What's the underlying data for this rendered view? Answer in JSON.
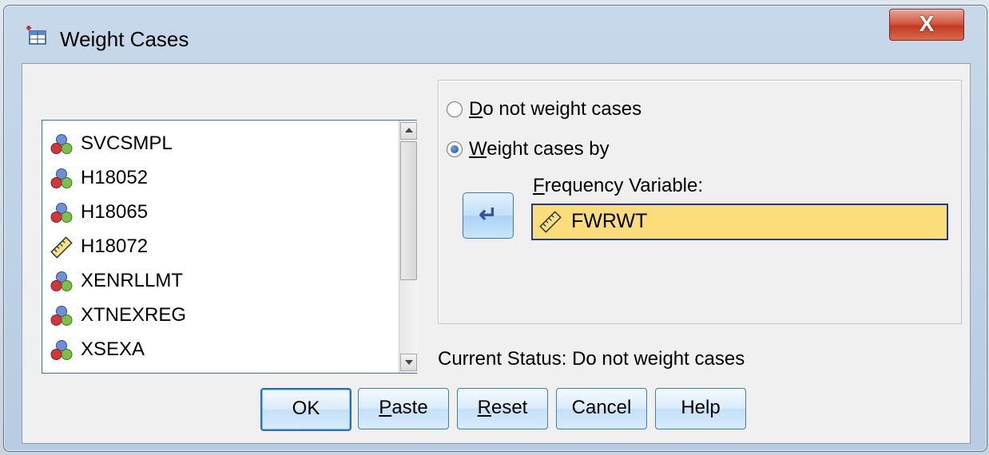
{
  "window": {
    "title": "Weight Cases",
    "close_label": "X"
  },
  "variables": [
    {
      "name": "SVCSMPL",
      "icon": "nominal-icon"
    },
    {
      "name": "H18052",
      "icon": "nominal-icon"
    },
    {
      "name": "H18065",
      "icon": "nominal-icon"
    },
    {
      "name": "H18072",
      "icon": "scale-ruler-icon"
    },
    {
      "name": "XENRLLMT",
      "icon": "nominal-icon"
    },
    {
      "name": "XTNEXREG",
      "icon": "nominal-icon"
    },
    {
      "name": "XSEXA",
      "icon": "nominal-icon"
    }
  ],
  "options": {
    "do_not_weight": {
      "label_first": "D",
      "label_rest": "o not weight cases",
      "checked": false
    },
    "weight_by": {
      "label_first": "W",
      "label_rest": "eight cases by",
      "checked": true
    }
  },
  "frequency": {
    "label_first": "F",
    "label_rest": "requency Variable:",
    "value": "FWRWT",
    "icon": "scale-ruler-icon"
  },
  "status_text": "Current Status: Do not weight cases",
  "buttons": {
    "ok": "OK",
    "paste_first": "P",
    "paste_rest": "aste",
    "reset_first": "R",
    "reset_rest": "eset",
    "cancel": "Cancel",
    "help": "Help"
  },
  "colors": {
    "field_highlight": "#fcdd7a",
    "button_border": "#3c7fb1",
    "close_red": "#c13b22"
  }
}
